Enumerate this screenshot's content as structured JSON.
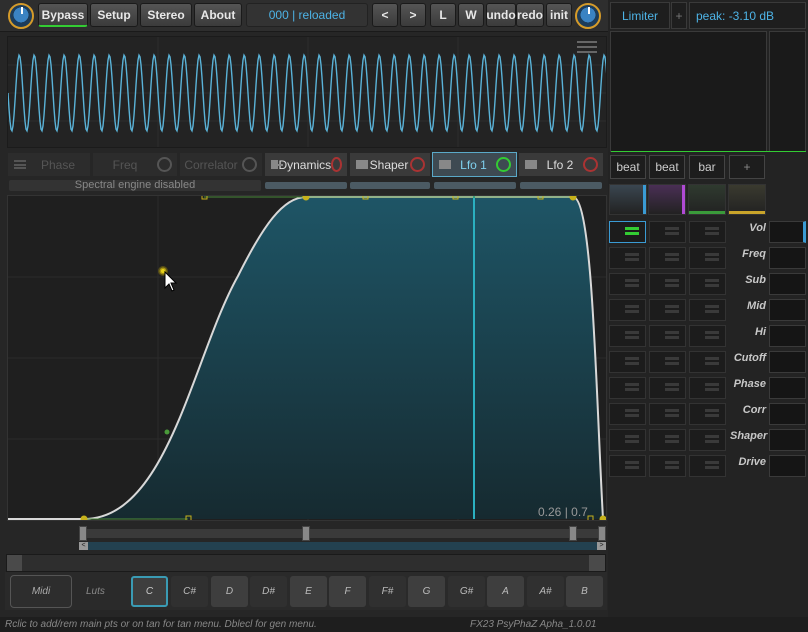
{
  "topbar": {
    "bypass": "Bypass",
    "setup": "Setup",
    "stereo": "Stereo",
    "about": "About",
    "preset_display": "000 | reloaded",
    "prev": "<",
    "next": ">",
    "load": "L",
    "write": "W",
    "undo": "undo",
    "redo": "redo",
    "init": "init"
  },
  "right_panel": {
    "limiter": "Limiter",
    "plus": "+",
    "peak": "peak: -3.10 dB",
    "triggers": [
      "beat",
      "beat",
      "bar",
      "+"
    ],
    "rows": [
      "Vol",
      "Freq",
      "Sub",
      "Mid",
      "Hi",
      "Cutoff",
      "Phase",
      "Corr",
      "Shaper",
      "Drive"
    ]
  },
  "tabs": [
    {
      "label": "Phase",
      "state": "off"
    },
    {
      "label": "Freq",
      "state": "off"
    },
    {
      "label": "Correlator",
      "state": "off"
    },
    {
      "label": "Dynamics",
      "state": "on"
    },
    {
      "label": "Shaper",
      "state": "on"
    },
    {
      "label": "Lfo 1",
      "state": "selected"
    },
    {
      "label": "Lfo 2",
      "state": "on"
    }
  ],
  "spectral_msg": "Spectral engine disabled",
  "graph": {
    "readout": "0.26 | 0.7"
  },
  "keys": {
    "midi": "Midi",
    "luts": "Luts",
    "notes": [
      "C",
      "C#",
      "D",
      "D#",
      "E",
      "F",
      "F#",
      "G",
      "G#",
      "A",
      "A#",
      "B"
    ]
  },
  "status": {
    "hint": "Rclic to add/rem main pts or on tan for tan menu. Dblecl for gen menu.",
    "version": "FX23 PsyPhaZ Apha_1.0.01"
  },
  "colors": {
    "accent": "#5ab3d8",
    "fill": "#1c4a5a",
    "curve": "#d8d8d8",
    "point": "#c7b21b"
  }
}
